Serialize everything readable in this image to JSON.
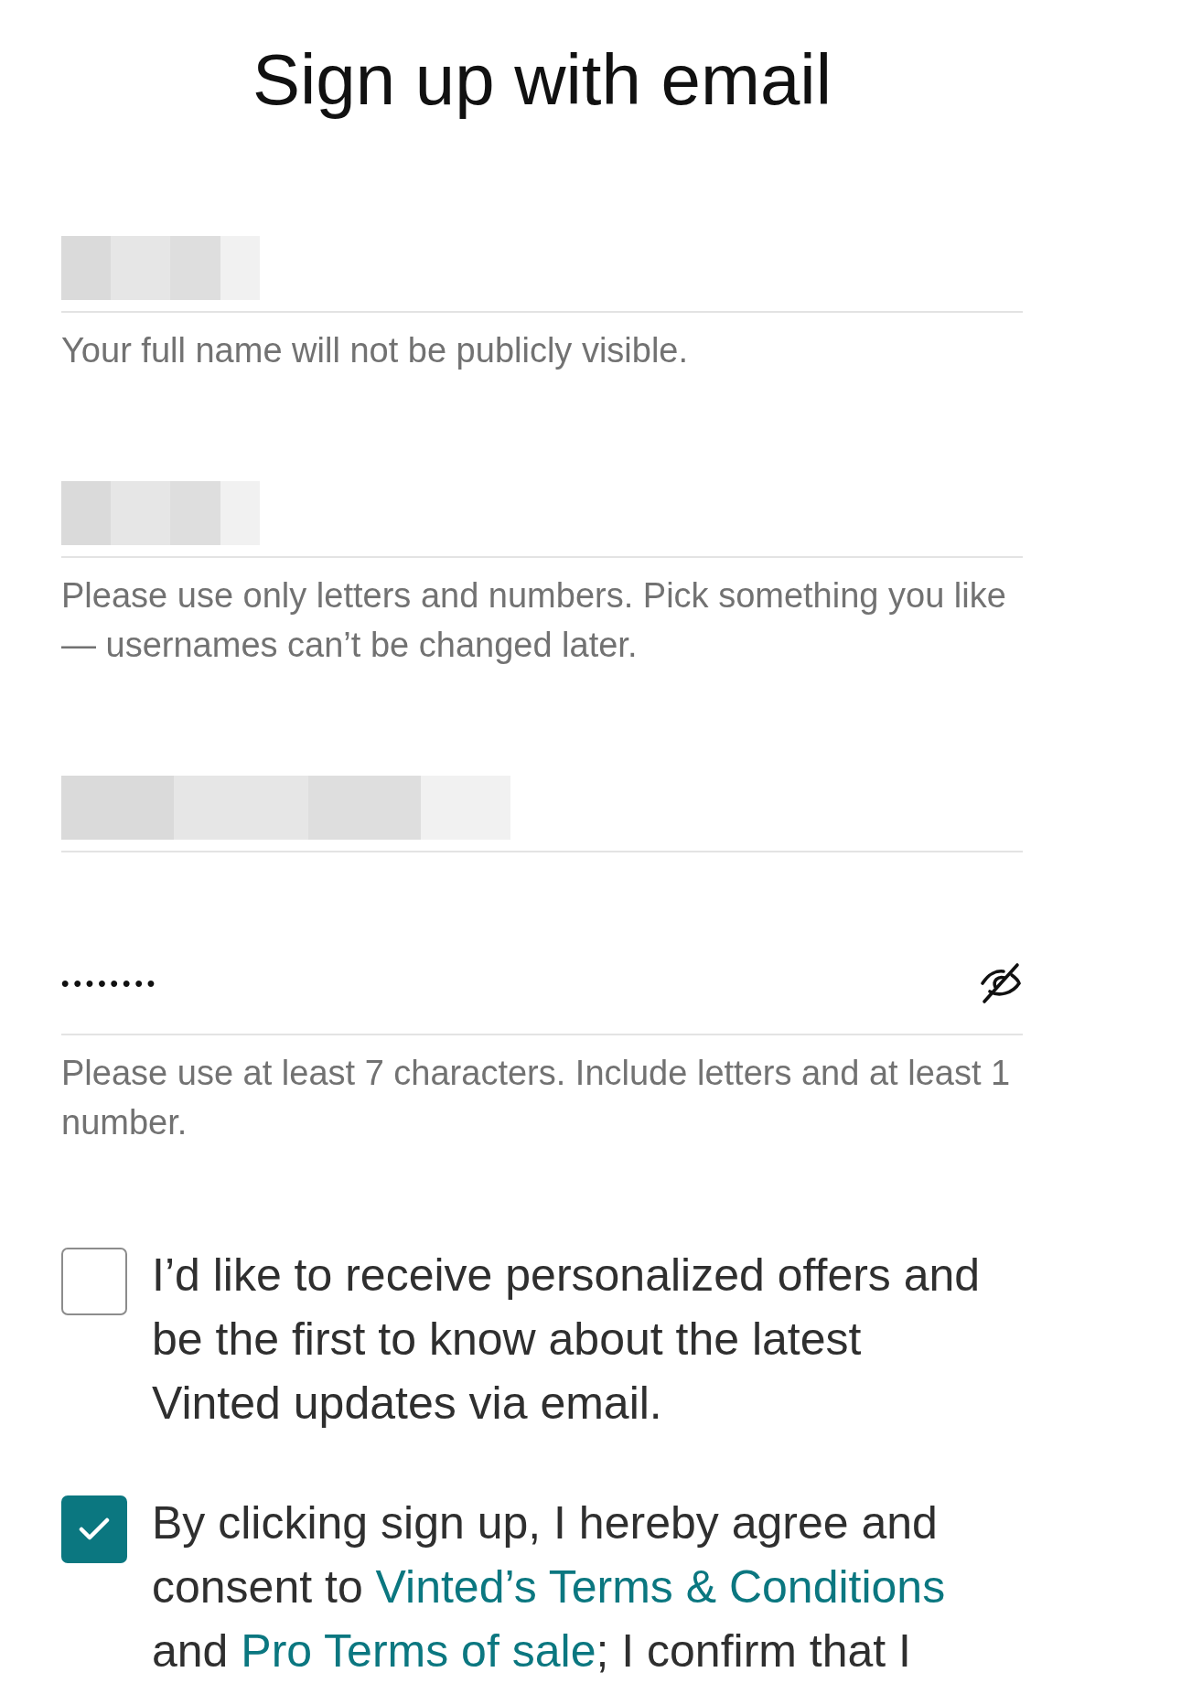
{
  "title": "Sign up with email",
  "fields": [
    {
      "kind": "text",
      "hint": "Your full name will not be publicly visible."
    },
    {
      "kind": "text",
      "hint": "Please use only letters and numbers. Pick something you like — usernames can’t be changed later."
    },
    {
      "kind": "text"
    },
    {
      "kind": "password",
      "value": "••••••••",
      "hint": "Please use at least 7 characters. Include letters and at least 1 number."
    }
  ],
  "checkboxes": [
    {
      "checked": false,
      "parts": [
        {
          "kind": "text",
          "text": "I’d like to receive personalized offers and be the first to know about the latest Vinted updates via email."
        }
      ]
    },
    {
      "checked": true,
      "parts": [
        {
          "kind": "text",
          "text": "By clicking sign up, I hereby agree and consent to "
        },
        {
          "kind": "link",
          "text": "Vinted’s Terms & Conditions"
        },
        {
          "kind": "text",
          "text": " and "
        },
        {
          "kind": "link",
          "text": "Pro Terms of sale"
        },
        {
          "kind": "text",
          "text": "; I confirm that I"
        }
      ]
    }
  ]
}
